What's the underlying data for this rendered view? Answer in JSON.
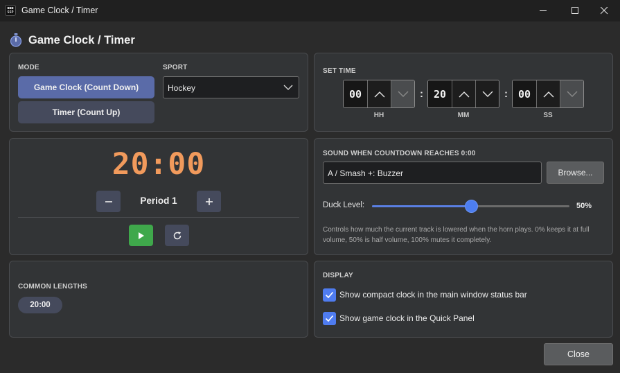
{
  "window": {
    "title": "Game Clock / Timer",
    "icon_text_top": "●●●",
    "icon_text_bottom": "SSP"
  },
  "header": {
    "title": "Game Clock / Timer",
    "icon": "stopwatch-icon"
  },
  "mode": {
    "label": "MODE",
    "buttons": [
      {
        "label": "Game Clock (Count Down)",
        "active": true
      },
      {
        "label": "Timer (Count Up)",
        "active": false
      }
    ]
  },
  "sport": {
    "label": "SPORT",
    "selected": "Hockey"
  },
  "set_time": {
    "label": "SET TIME",
    "hours": {
      "value": "00",
      "unit": "HH"
    },
    "minutes": {
      "value": "20",
      "unit": "MM"
    },
    "seconds": {
      "value": "00",
      "unit": "SS"
    },
    "separator": ":"
  },
  "clock": {
    "display": "20:00",
    "period": "Period 1",
    "colors": {
      "digits": "#f19a5c",
      "play": "#3fa84b"
    }
  },
  "sound": {
    "label": "SOUND WHEN COUNTDOWN REACHES 0:00",
    "file": "A / Smash +: Buzzer",
    "browse_label": "Browse...",
    "duck_label": "Duck Level:",
    "duck_value_text": "50%",
    "duck_level": 0.5,
    "help": "Controls how much the current track is lowered when the horn plays. 0% keeps it at full volume, 50% is half volume, 100% mutes it completely."
  },
  "common": {
    "label": "COMMON LENGTHS",
    "items": [
      "20:00"
    ]
  },
  "display": {
    "label": "DISPLAY",
    "options": [
      {
        "label": "Show compact clock in the main window status bar",
        "checked": true
      },
      {
        "label": "Show game clock in the Quick Panel",
        "checked": true
      }
    ]
  },
  "footer": {
    "close_label": "Close"
  },
  "colors": {
    "accent": "#5a6ba8",
    "checkbox": "#4f7cf0",
    "background": "#2b2b2b",
    "panel": "#323436"
  }
}
